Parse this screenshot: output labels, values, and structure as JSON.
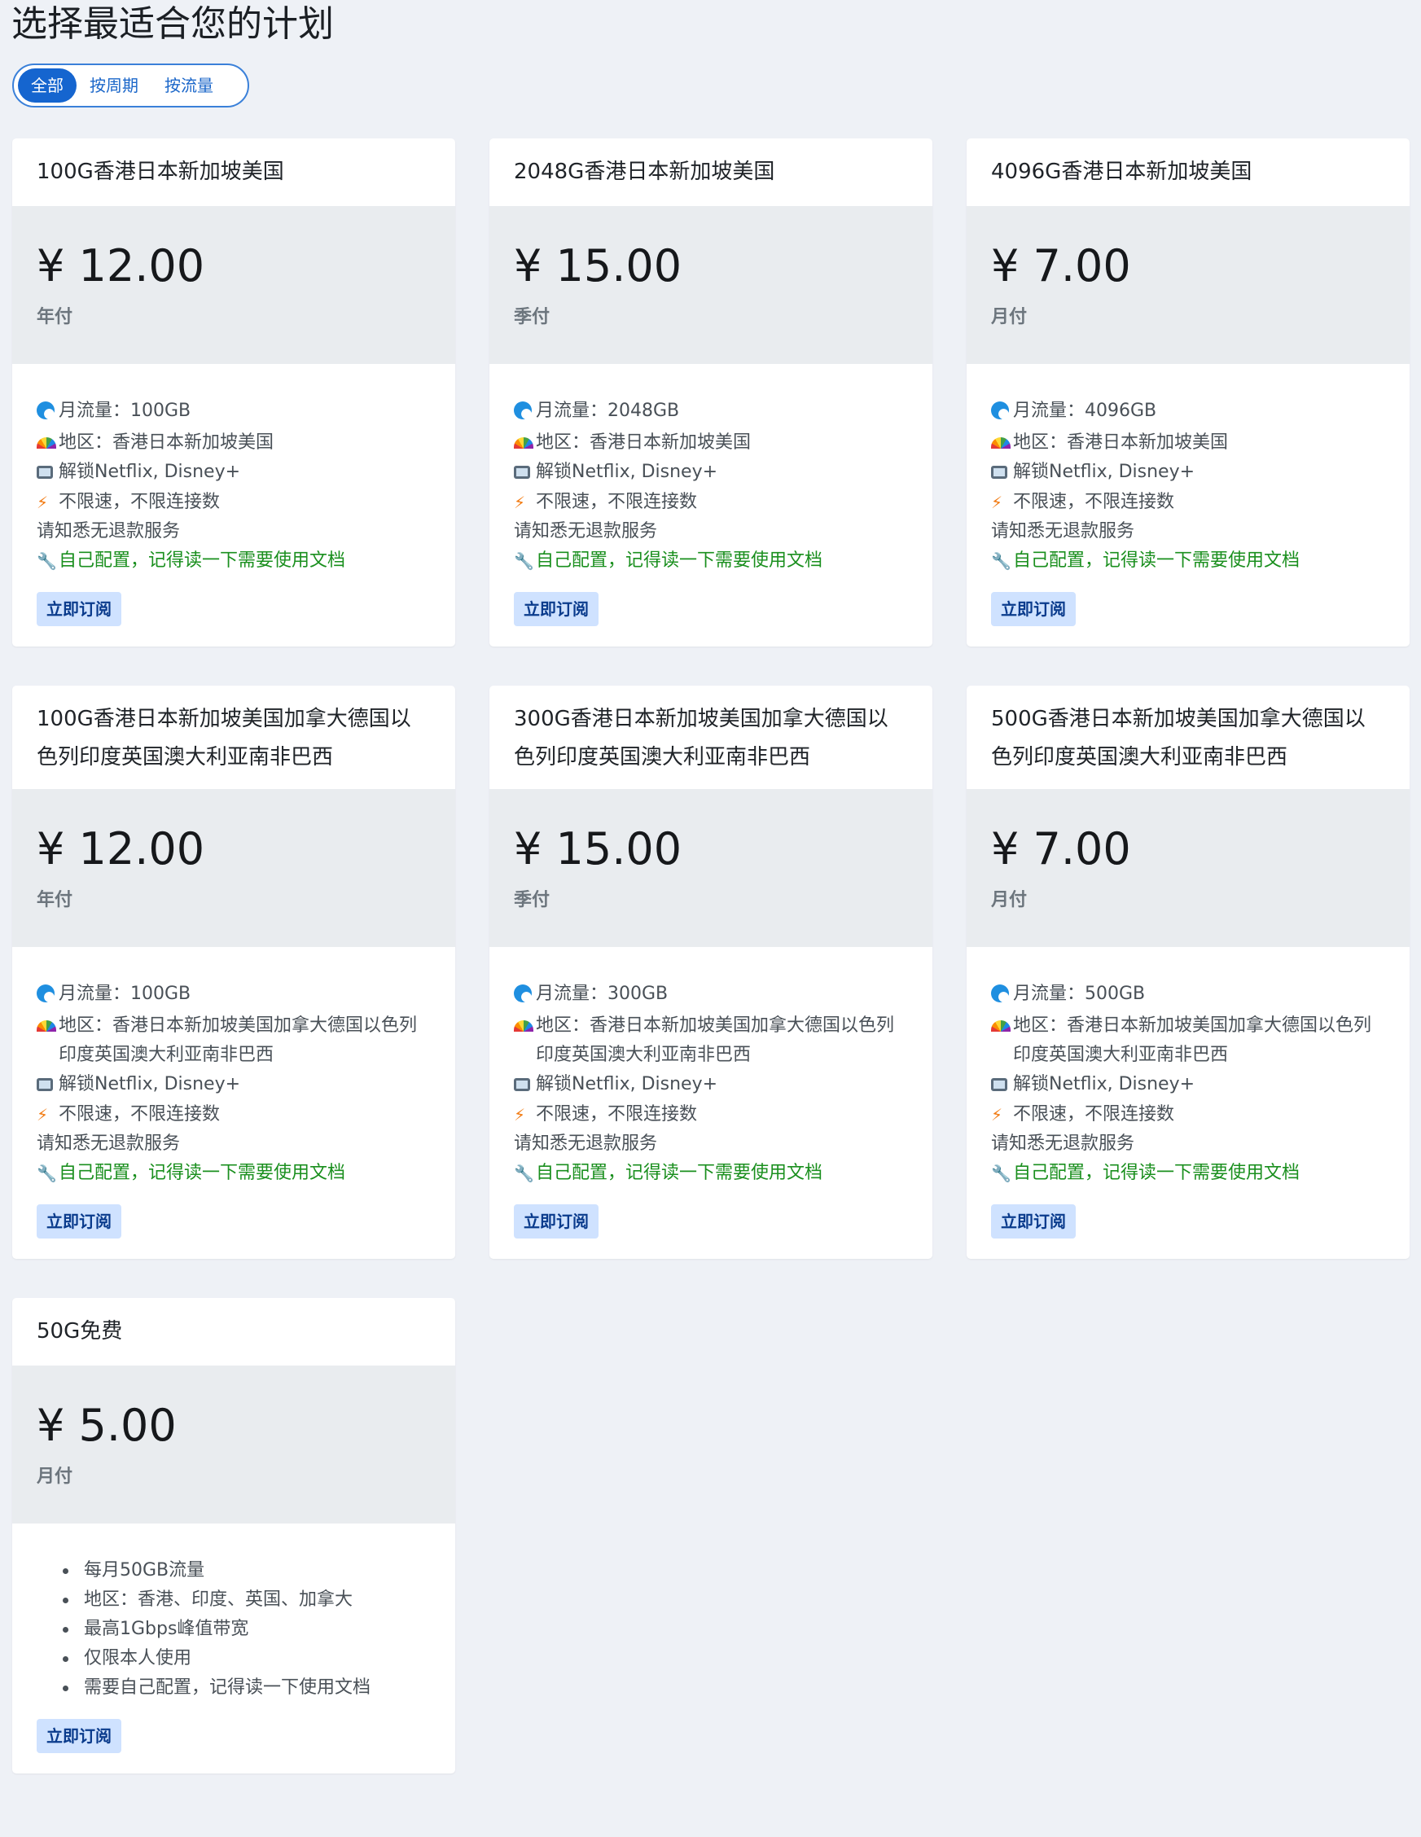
{
  "page": {
    "title": "选择最适合您的计划"
  },
  "filters": [
    {
      "label": "全部",
      "active": true
    },
    {
      "label": "按周期",
      "active": false
    },
    {
      "label": "按流量",
      "active": false
    }
  ],
  "subscribe_label": "立即订阅",
  "plans": [
    {
      "name": "100G香港日本新加坡美国",
      "price": "¥ 12.00",
      "period": "年付",
      "features": [
        {
          "icon": "wave-icon",
          "text": "月流量：100GB"
        },
        {
          "icon": "rainbow-icon",
          "text": "地区：香港日本新加坡美国"
        },
        {
          "icon": "tv-icon",
          "text": "解锁Netflix, Disney+"
        },
        {
          "icon": "lightning-icon",
          "text": "不限速，不限连接数"
        },
        {
          "icon": "",
          "text": "请知悉无退款服务"
        },
        {
          "icon": "wrench-icon",
          "text": "自己配置，记得读一下需要使用文档",
          "color": "#1a8f1e"
        }
      ]
    },
    {
      "name": "2048G香港日本新加坡美国",
      "price": "¥ 15.00",
      "period": "季付",
      "features": [
        {
          "icon": "wave-icon",
          "text": "月流量：2048GB"
        },
        {
          "icon": "rainbow-icon",
          "text": "地区：香港日本新加坡美国"
        },
        {
          "icon": "tv-icon",
          "text": "解锁Netflix, Disney+"
        },
        {
          "icon": "lightning-icon",
          "text": "不限速，不限连接数"
        },
        {
          "icon": "",
          "text": "请知悉无退款服务"
        },
        {
          "icon": "wrench-icon",
          "text": "自己配置，记得读一下需要使用文档",
          "color": "#1a8f1e"
        }
      ]
    },
    {
      "name": "4096G香港日本新加坡美国",
      "price": "¥ 7.00",
      "period": "月付",
      "features": [
        {
          "icon": "wave-icon",
          "text": "月流量：4096GB"
        },
        {
          "icon": "rainbow-icon",
          "text": "地区：香港日本新加坡美国"
        },
        {
          "icon": "tv-icon",
          "text": "解锁Netflix, Disney+"
        },
        {
          "icon": "lightning-icon",
          "text": "不限速，不限连接数"
        },
        {
          "icon": "",
          "text": "请知悉无退款服务"
        },
        {
          "icon": "wrench-icon",
          "text": "自己配置，记得读一下需要使用文档",
          "color": "#1a8f1e"
        }
      ]
    },
    {
      "name": "100G香港日本新加坡美国加拿大德国以色列印度英国澳大利亚南非巴西",
      "price": "¥ 12.00",
      "period": "年付",
      "features": [
        {
          "icon": "wave-icon",
          "text": "月流量：100GB"
        },
        {
          "icon": "rainbow-icon",
          "text": "地区：香港日本新加坡美国加拿大德国以色列印度英国澳大利亚南非巴西"
        },
        {
          "icon": "tv-icon",
          "text": "解锁Netflix, Disney+"
        },
        {
          "icon": "lightning-icon",
          "text": "不限速，不限连接数"
        },
        {
          "icon": "",
          "text": "请知悉无退款服务"
        },
        {
          "icon": "wrench-icon",
          "text": "自己配置，记得读一下需要使用文档",
          "color": "#1a8f1e"
        }
      ]
    },
    {
      "name": "300G香港日本新加坡美国加拿大德国以色列印度英国澳大利亚南非巴西",
      "price": "¥ 15.00",
      "period": "季付",
      "features": [
        {
          "icon": "wave-icon",
          "text": "月流量：300GB"
        },
        {
          "icon": "rainbow-icon",
          "text": "地区：香港日本新加坡美国加拿大德国以色列印度英国澳大利亚南非巴西"
        },
        {
          "icon": "tv-icon",
          "text": "解锁Netflix, Disney+"
        },
        {
          "icon": "lightning-icon",
          "text": "不限速，不限连接数"
        },
        {
          "icon": "",
          "text": "请知悉无退款服务"
        },
        {
          "icon": "wrench-icon",
          "text": "自己配置，记得读一下需要使用文档",
          "color": "#1a8f1e"
        }
      ]
    },
    {
      "name": "500G香港日本新加坡美国加拿大德国以色列印度英国澳大利亚南非巴西",
      "price": "¥ 7.00",
      "period": "月付",
      "features": [
        {
          "icon": "wave-icon",
          "text": "月流量：500GB"
        },
        {
          "icon": "rainbow-icon",
          "text": "地区：香港日本新加坡美国加拿大德国以色列印度英国澳大利亚南非巴西"
        },
        {
          "icon": "tv-icon",
          "text": "解锁Netflix, Disney+"
        },
        {
          "icon": "lightning-icon",
          "text": "不限速，不限连接数"
        },
        {
          "icon": "",
          "text": "请知悉无退款服务"
        },
        {
          "icon": "wrench-icon",
          "text": "自己配置，记得读一下需要使用文档",
          "color": "#1a8f1e"
        }
      ]
    },
    {
      "name": "50G免费",
      "price": "¥ 5.00",
      "period": "月付",
      "bullets": [
        "每月50GB流量",
        "地区：香港、印度、英国、加拿大",
        "最高1Gbps峰值带宽",
        "仅限本人使用",
        "需要自己配置，记得读一下使用文档"
      ]
    }
  ],
  "colors": {
    "accent": "#1565cf",
    "background": "#eef1f6",
    "price_block": "#e9ecef",
    "button_bg": "#cfe2ff",
    "green_text": "#1a8f1e"
  }
}
